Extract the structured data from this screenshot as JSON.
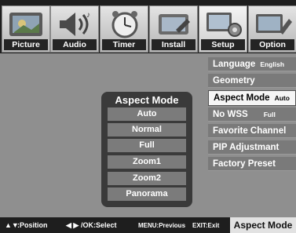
{
  "tabs": [
    {
      "label": "Picture"
    },
    {
      "label": "Audio"
    },
    {
      "label": "Timer"
    },
    {
      "label": "Install"
    },
    {
      "label": "Setup"
    },
    {
      "label": "Option"
    }
  ],
  "setup_menu": {
    "items": [
      {
        "label": "Language",
        "value": "English"
      },
      {
        "label": "Geometry",
        "value": ""
      },
      {
        "label": "Aspect Mode",
        "value": "Auto"
      },
      {
        "label": "No WSS",
        "value": "Full"
      },
      {
        "label": "Favorite Channel",
        "value": ""
      },
      {
        "label": "PIP Adjustmant",
        "value": ""
      },
      {
        "label": "Factory Preset",
        "value": ""
      }
    ]
  },
  "aspect_popup": {
    "title": "Aspect Mode",
    "options": [
      "Auto",
      "Normal",
      "Full",
      "Zoom1",
      "Zoom2",
      "Panorama"
    ]
  },
  "footer": {
    "position_hint": ":Position",
    "ok_hint": "/OK:Select",
    "menu_hint": "MENU:Previous",
    "exit_hint": "EXIT:Exit",
    "status": "Aspect Mode"
  },
  "icons": {
    "up_down": "up-down-arrows-icon",
    "left_right": "left-right-arrows-icon"
  }
}
